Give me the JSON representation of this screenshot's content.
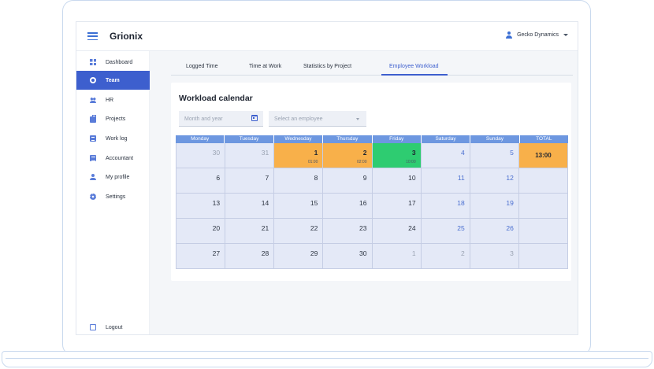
{
  "app": {
    "brand": "Grionix",
    "user": "Gecko Dynamics"
  },
  "sidebar": {
    "items": [
      {
        "label": "Dashboard",
        "icon": "dashboard-icon"
      },
      {
        "label": "Team",
        "icon": "team-icon",
        "active": true
      },
      {
        "label": "HR",
        "icon": "hr-icon"
      },
      {
        "label": "Projects",
        "icon": "briefcase-icon"
      },
      {
        "label": "Work log",
        "icon": "worklog-icon"
      },
      {
        "label": "Accountant",
        "icon": "accountant-icon"
      },
      {
        "label": "My profile",
        "icon": "profile-icon"
      },
      {
        "label": "Settings",
        "icon": "gear-icon"
      }
    ],
    "logout": "Logout"
  },
  "tabs": [
    {
      "label": "Logged Time"
    },
    {
      "label": "Time at Work"
    },
    {
      "label": "Statistics by Project"
    },
    {
      "label": "Employee Workload",
      "active": true
    }
  ],
  "card": {
    "title": "Workload calendar",
    "month_placeholder": "Month and year",
    "employee_placeholder": "Select an employee"
  },
  "calendar": {
    "headers": [
      "Monday",
      "Tuesday",
      "Wednesday",
      "Thursday",
      "Friday",
      "Saturday",
      "Sunday",
      "TOTAL"
    ],
    "rows": [
      [
        {
          "d": "30",
          "s": "muted"
        },
        {
          "d": "31",
          "s": "muted"
        },
        {
          "d": "1",
          "s": "orange",
          "h": "01:00"
        },
        {
          "d": "2",
          "s": "orange",
          "h": "02:00"
        },
        {
          "d": "3",
          "s": "green",
          "h": "10:00"
        },
        {
          "d": "4",
          "s": "weekend"
        },
        {
          "d": "5",
          "s": "weekend"
        },
        {
          "d": "13:00",
          "s": "total-orange"
        }
      ],
      [
        {
          "d": "6"
        },
        {
          "d": "7"
        },
        {
          "d": "8"
        },
        {
          "d": "9"
        },
        {
          "d": "10"
        },
        {
          "d": "11",
          "s": "weekend"
        },
        {
          "d": "12",
          "s": "weekend"
        },
        {
          "d": "",
          "s": "total"
        }
      ],
      [
        {
          "d": "13"
        },
        {
          "d": "14"
        },
        {
          "d": "15"
        },
        {
          "d": "16"
        },
        {
          "d": "17"
        },
        {
          "d": "18",
          "s": "weekend"
        },
        {
          "d": "19",
          "s": "weekend"
        },
        {
          "d": "",
          "s": "total"
        }
      ],
      [
        {
          "d": "20"
        },
        {
          "d": "21"
        },
        {
          "d": "22"
        },
        {
          "d": "23"
        },
        {
          "d": "24"
        },
        {
          "d": "25",
          "s": "weekend"
        },
        {
          "d": "26",
          "s": "weekend"
        },
        {
          "d": "",
          "s": "total"
        }
      ],
      [
        {
          "d": "27"
        },
        {
          "d": "28"
        },
        {
          "d": "29"
        },
        {
          "d": "30"
        },
        {
          "d": "1",
          "s": "muted"
        },
        {
          "d": "2",
          "s": "muted"
        },
        {
          "d": "3",
          "s": "muted"
        },
        {
          "d": "",
          "s": "total"
        }
      ]
    ]
  },
  "colors": {
    "accent": "#3d5fce",
    "header": "#6d97e0",
    "cell": "#e4e9f7",
    "partial": "#f8b04a",
    "full": "#2ecc71"
  }
}
